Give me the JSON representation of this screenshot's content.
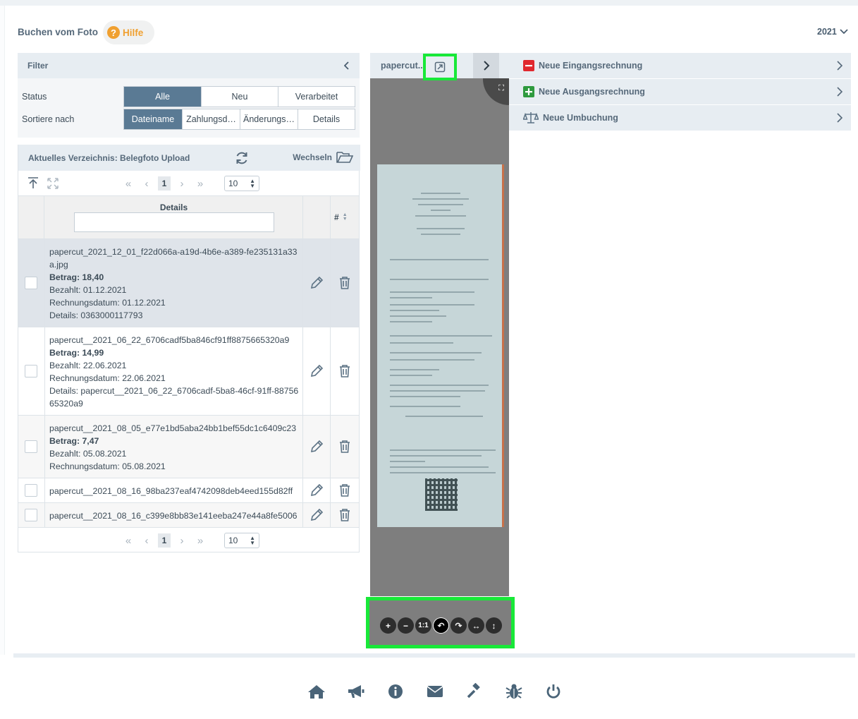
{
  "header": {
    "title": "Buchen vom Foto",
    "help_label": "Hilfe",
    "help_icon": "question-circle-icon",
    "year": "2021"
  },
  "filter": {
    "title": "Filter",
    "status_label": "Status",
    "status_options": [
      "Alle",
      "Neu",
      "Verarbeitet"
    ],
    "status_selected": "Alle",
    "sort_label": "Sortiere nach",
    "sort_options": [
      "Dateiname",
      "Zahlungsd…",
      "Änderungs…",
      "Details"
    ],
    "sort_selected": "Dateiname"
  },
  "directory": {
    "title": "Aktuelles Verzeichnis: Belegfoto Upload",
    "switch_label": "Wechseln",
    "page": "1",
    "page_size": "10",
    "column_details": "Details",
    "column_hash": "#",
    "rows": [
      {
        "name": "papercut_2021_12_01_f22d066a-a19d-4b6e-a389-fe235131a33a.jpg",
        "amount": "Betrag: 18,40",
        "paid": "Bezahlt: 01.12.2021",
        "invoice_date": "Rechnungsdatum: 01.12.2021",
        "details": "Details: 0363000117793",
        "selected": true
      },
      {
        "name": "papercut__2021_06_22_6706cadf5ba846cf91ff8875665320a9",
        "amount": "Betrag: 14,99",
        "paid": "Bezahlt: 22.06.2021",
        "invoice_date": "Rechnungsdatum: 22.06.2021",
        "details": "Details: papercut__2021_06_22_6706cadf-5ba8-46cf-91ff-8875665320a9",
        "selected": false
      },
      {
        "name": "papercut__2021_08_05_e77e1bd5aba24bb1bef55dc1c6409c23",
        "amount": "Betrag: 7,47",
        "paid": "Bezahlt: 05.08.2021",
        "invoice_date": "Rechnungsdatum: 05.08.2021",
        "selected": false
      },
      {
        "name": "papercut__2021_08_16_98ba237eaf4742098deb4eed155d82ff",
        "selected": false
      },
      {
        "name": "papercut__2021_08_16_c399e8bb83e141eeba247e44a8fe5006",
        "selected": false
      }
    ]
  },
  "preview": {
    "title": "papercut..",
    "tools": [
      "+",
      "−",
      "1:1",
      "↶",
      "↷",
      "↔",
      "↕"
    ]
  },
  "actions": [
    {
      "label": "Neue Eingangsrechnung",
      "icon": "minus-square-icon",
      "color": "#e0282e"
    },
    {
      "label": "Neue Ausgangsrechnung",
      "icon": "plus-square-icon",
      "color": "#2e9a3e"
    },
    {
      "label": "Neue Umbuchung",
      "icon": "balance-scale-icon",
      "color": "#5c7284"
    }
  ],
  "footer_icons": [
    "home-icon",
    "megaphone-icon",
    "info-icon",
    "envelope-icon",
    "gavel-icon",
    "bug-icon",
    "power-icon"
  ],
  "colors": {
    "accent": "#5a7a94",
    "panel_header": "#e7edf2",
    "highlight": "#18e838",
    "help": "#f0a030"
  }
}
